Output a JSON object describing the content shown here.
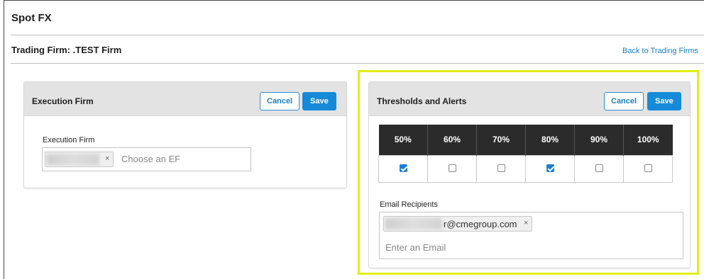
{
  "page": {
    "title": "Spot FX",
    "firm_title": "Trading Firm: .TEST Firm",
    "back_link": "Back to Trading Firms"
  },
  "execution_panel": {
    "title": "Execution Firm",
    "cancel_label": "Cancel",
    "save_label": "Save",
    "field_label": "Execution Firm",
    "chip_remove": "×",
    "placeholder": "Choose an EF"
  },
  "thresholds_panel": {
    "title": "Thresholds and Alerts",
    "cancel_label": "Cancel",
    "save_label": "Save",
    "thresholds": [
      {
        "label": "50%",
        "checked": true
      },
      {
        "label": "60%",
        "checked": false
      },
      {
        "label": "70%",
        "checked": false
      },
      {
        "label": "80%",
        "checked": true
      },
      {
        "label": "90%",
        "checked": false
      },
      {
        "label": "100%",
        "checked": false
      }
    ],
    "email_label": "Email Recipients",
    "email_chip_text": "r@cmegroup.com",
    "chip_remove": "×",
    "email_placeholder": "Enter an Email"
  },
  "colors": {
    "accent": "#168ad8",
    "highlight_border": "#e2ef12",
    "table_header": "#2b2b2b"
  }
}
